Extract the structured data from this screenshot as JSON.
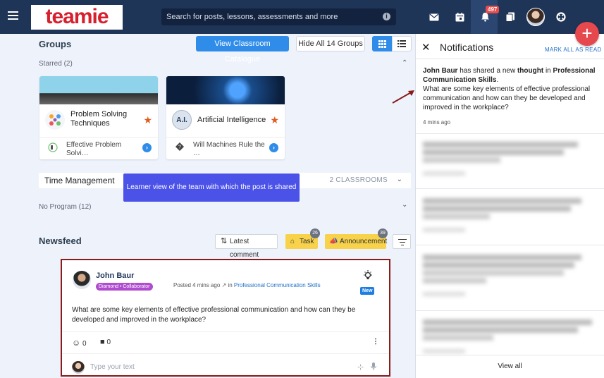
{
  "topbar": {
    "logo": "teamie",
    "search_placeholder": "Search for posts, lessons, assessments and more",
    "notif_count": "497"
  },
  "groups": {
    "title": "Groups",
    "catalogue_button": "View Classroom Catalogue",
    "hide_button": "Hide All 14 Groups",
    "starred_label": "Starred (2)",
    "cards": [
      {
        "title": "Problem Solving Techniques",
        "subtitle": "Effective Problem Solvi…",
        "icon_text": ""
      },
      {
        "title": "Artificial Intelligence",
        "subtitle": "Will Machines Rule the …",
        "icon_text": "A.I."
      }
    ]
  },
  "time_management": {
    "title": "Time Management",
    "count": "2 CLASSROOMS"
  },
  "tooltip": "Learner view of the team with which the post is shared",
  "no_program": "No Program (12)",
  "newsfeed": {
    "title": "Newsfeed",
    "latest_comment": "Latest comment",
    "task": "Task",
    "task_count": "26",
    "announcement": "Announcement",
    "announcement_count": "39"
  },
  "post": {
    "author": "John Baur",
    "role": "Diamond • Collaborator",
    "posted": "Posted 4 mins ago",
    "in": "in",
    "group_link": "Professional Communication Skills",
    "new_badge": "New",
    "body": "What are some key elements of effective professional communication and how can they be developed and improved in the workplace?",
    "reactions": "0",
    "comments": "0",
    "comment_placeholder": "Type your text"
  },
  "notifications": {
    "title": "Notifications",
    "mark_all": "MARK ALL AS READ",
    "first": {
      "actor": "John Baur",
      "text1": "has shared a new",
      "kind": "thought",
      "text2": "in",
      "group": "Professional Communication Skills",
      "message": "What are some key elements of effective professional communication and how can they be developed and improved in the workplace?",
      "ago": "4 mins ago"
    },
    "view_all": "View all"
  },
  "colors": {
    "topbar": "#1f3557",
    "accent": "#2f8ce9",
    "tooltip": "#4b52e8",
    "post_border": "#8b1a1a",
    "fab": "#e5484d"
  }
}
